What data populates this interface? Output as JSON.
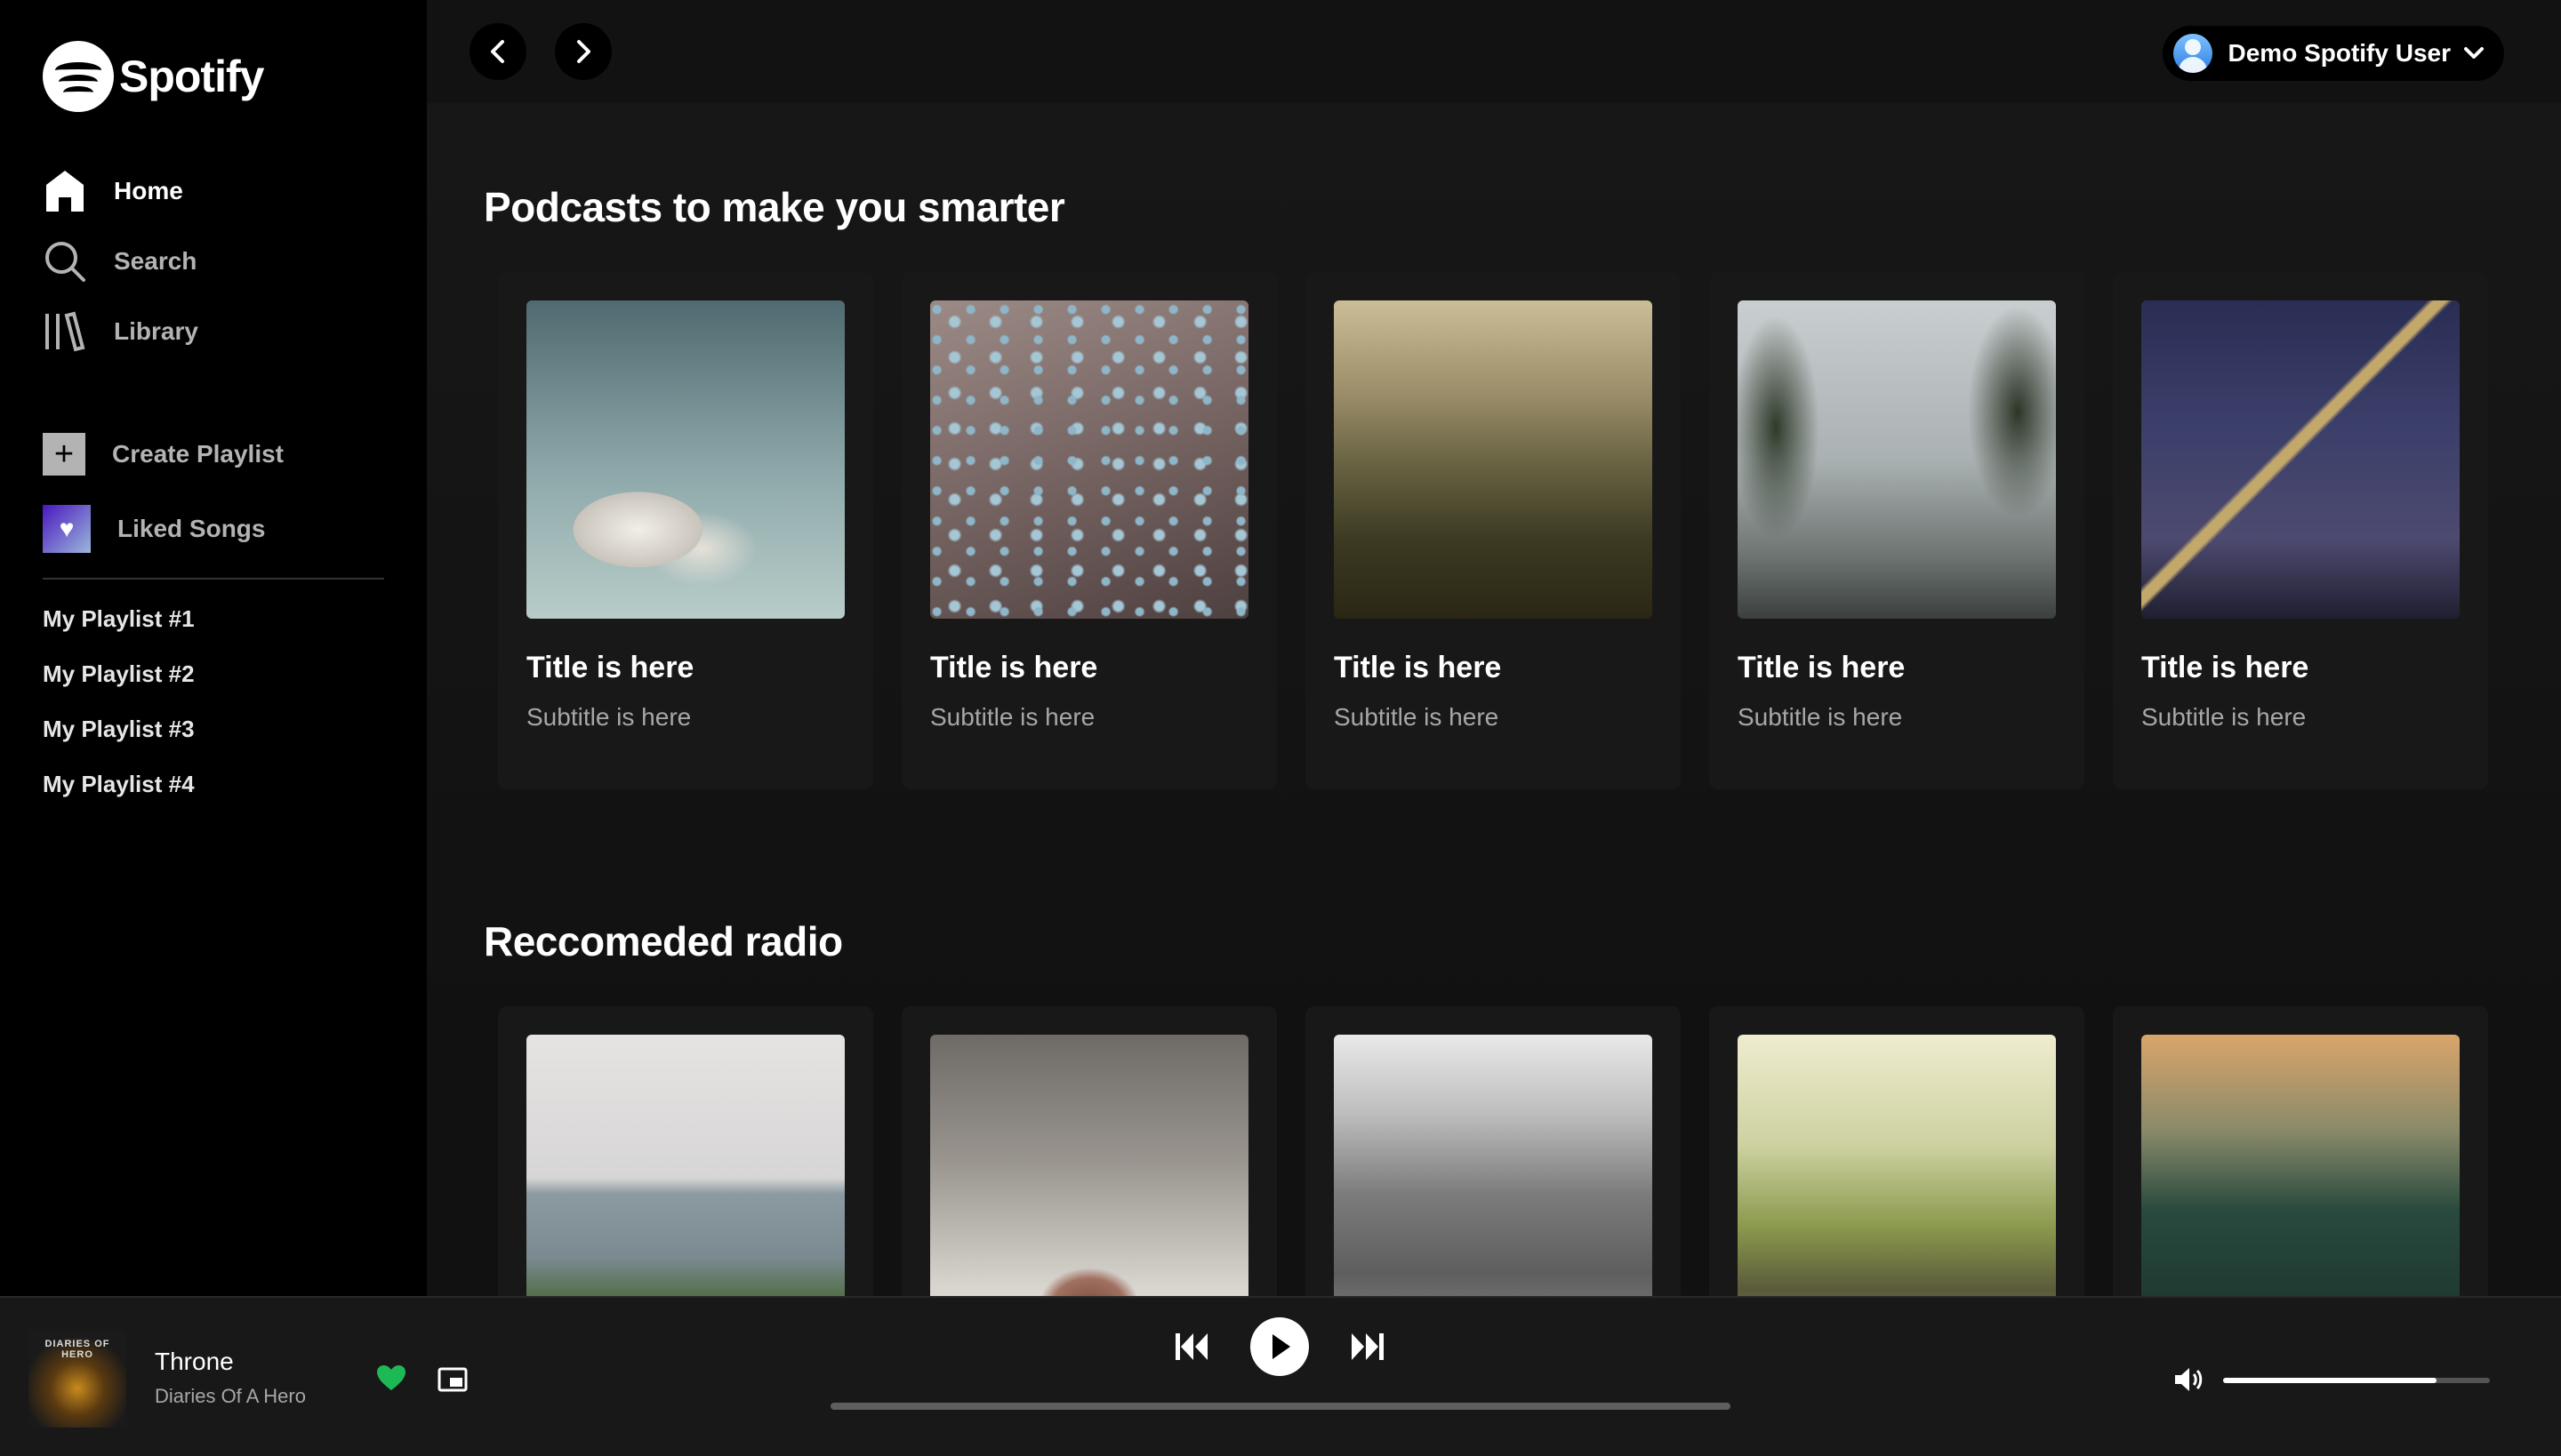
{
  "brand": {
    "name": "Spotify"
  },
  "sidebar": {
    "nav": [
      {
        "label": "Home",
        "icon": "home-icon",
        "active": true
      },
      {
        "label": "Search",
        "icon": "search-icon",
        "active": false
      },
      {
        "label": "Library",
        "icon": "library-icon",
        "active": false
      }
    ],
    "actions": [
      {
        "label": "Create Playlist",
        "icon": "plus-icon"
      },
      {
        "label": "Liked Songs",
        "icon": "heart-icon"
      }
    ],
    "playlists": [
      "My Playlist #1",
      "My Playlist #2",
      "My Playlist #3",
      "My Playlist #4"
    ]
  },
  "topbar": {
    "user_name": "Demo Spotify User"
  },
  "sections": [
    {
      "title": "Podcasts to make you smarter",
      "cards": [
        {
          "title": "Title is here",
          "subtitle": "Subtitle is here",
          "image": "clouds"
        },
        {
          "title": "Title is here",
          "subtitle": "Subtitle is here",
          "image": "water-drops"
        },
        {
          "title": "Title is here",
          "subtitle": "Subtitle is here",
          "image": "hills"
        },
        {
          "title": "Title is here",
          "subtitle": "Subtitle is here",
          "image": "tree-road"
        },
        {
          "title": "Title is here",
          "subtitle": "Subtitle is here",
          "image": "bridge"
        }
      ]
    },
    {
      "title": "Reccomeded radio",
      "cards": [
        {
          "image": "sea-coast"
        },
        {
          "image": "cat-nose"
        },
        {
          "image": "city"
        },
        {
          "image": "railway"
        },
        {
          "image": "forest"
        }
      ]
    }
  ],
  "player": {
    "track": "Throne",
    "artist": "Diaries Of A Hero",
    "liked": true,
    "volume": 0.8,
    "progress": 0.0
  },
  "colors": {
    "accent": "#1db954",
    "background": "#121212",
    "sidebar": "#000000",
    "card": "#181818"
  }
}
